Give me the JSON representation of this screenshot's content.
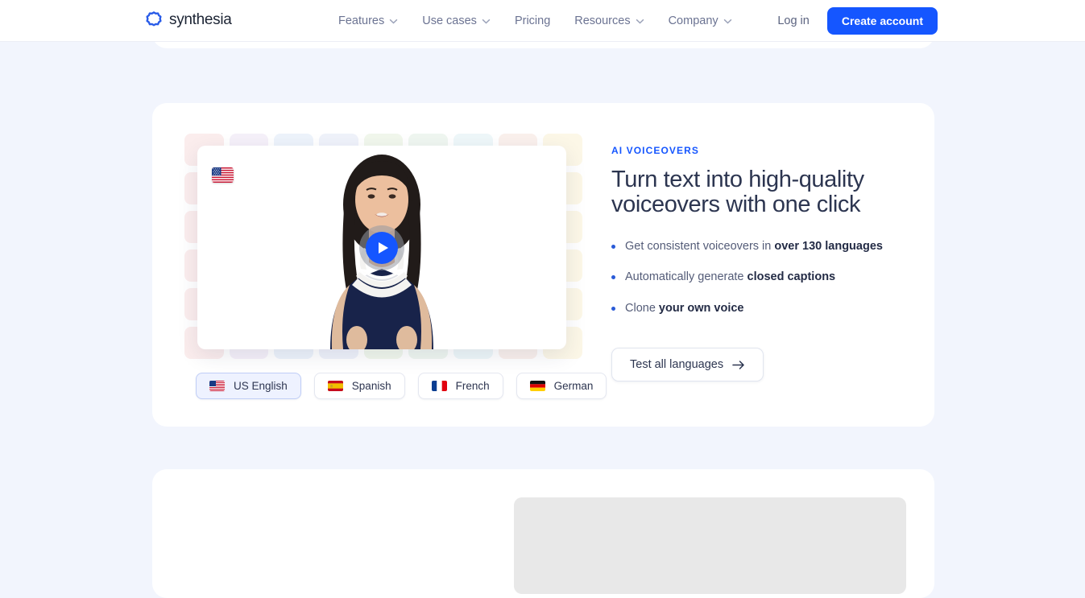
{
  "header": {
    "logo_text": "synthesia",
    "logo_icon": "synthesia-starburst-icon",
    "nav": [
      {
        "label": "Features",
        "has_chevron": true
      },
      {
        "label": "Use cases",
        "has_chevron": true
      },
      {
        "label": "Pricing",
        "has_chevron": false
      },
      {
        "label": "Resources",
        "has_chevron": true
      },
      {
        "label": "Company",
        "has_chevron": true
      }
    ],
    "login_label": "Log in",
    "cta_label": "Create account",
    "cta_color": "#1556ff"
  },
  "section": {
    "eyebrow": "AI VOICEOVERS",
    "headline": "Turn text into high-quality voiceovers with one click",
    "bullets": [
      {
        "lead": "Get consistent voiceovers in ",
        "strong": "over 130 languages",
        "tail": ""
      },
      {
        "lead": "Automatically generate ",
        "strong": "closed captions",
        "tail": ""
      },
      {
        "lead": "Clone ",
        "strong": "your own voice",
        "tail": ""
      }
    ],
    "button_label": "Test all languages",
    "button_icon": "arrow-right-icon"
  },
  "player": {
    "play_icon": "play-icon",
    "badge_flag": "us-flag-icon",
    "avatar": "presenter-avatar"
  },
  "languages": [
    {
      "label": "US English",
      "flag": "us-flag-icon",
      "selected": true
    },
    {
      "label": "Spanish",
      "flag": "es-flag-icon",
      "selected": false
    },
    {
      "label": "French",
      "flag": "fr-flag-icon",
      "selected": false
    },
    {
      "label": "German",
      "flag": "de-flag-icon",
      "selected": false
    }
  ],
  "theme": {
    "page_bg": "#f2f5fd",
    "card_bg": "#ffffff",
    "accent": "#1556ff",
    "heading": "#2c3550",
    "body_text": "#545c78"
  }
}
